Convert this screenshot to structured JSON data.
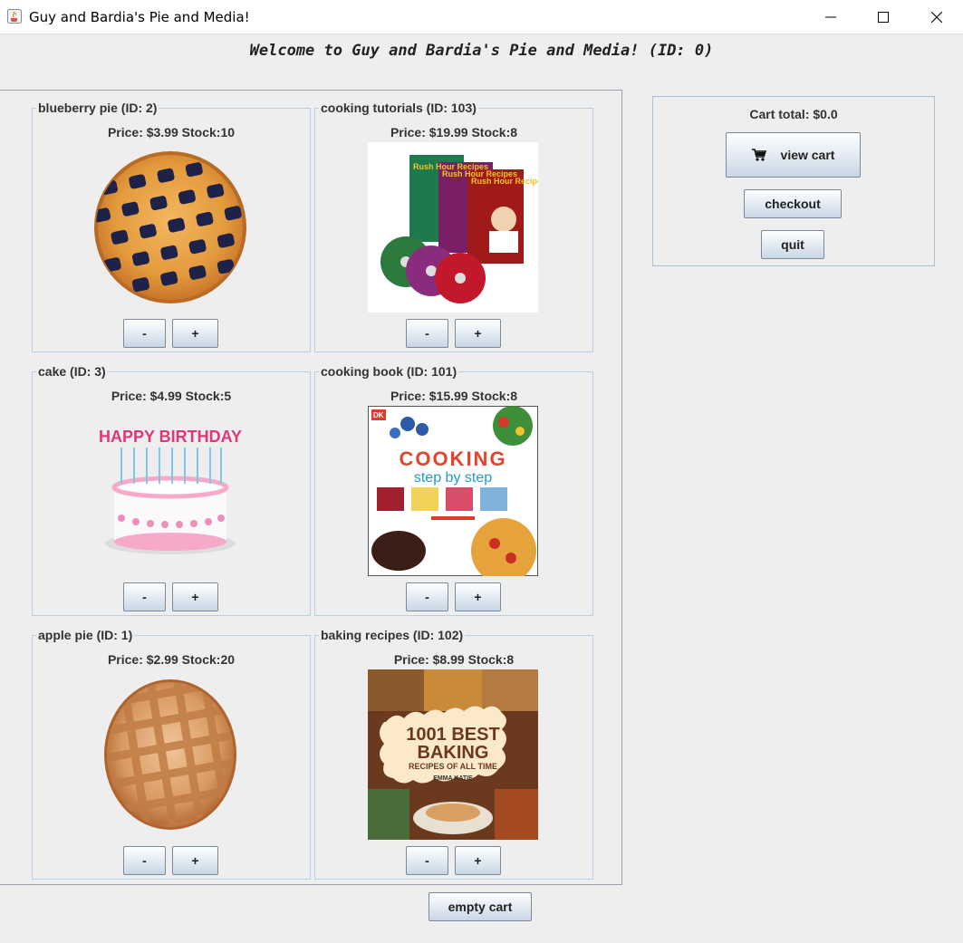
{
  "window": {
    "title": "Guy and Bardia's Pie and Media!",
    "controls": {
      "minimize": "minimize-icon",
      "maximize": "maximize-icon",
      "close": "close-icon"
    }
  },
  "welcome": "Welcome to Guy and Bardia's Pie and Media! (ID: 0)",
  "products": [
    {
      "name": "blueberry pie (ID: 2)",
      "info": "Price: $3.99 Stock:10",
      "image": "blueberry-pie-image"
    },
    {
      "name": "cooking tutorials (ID: 103)",
      "info": "Price: $19.99 Stock:8",
      "image": "cooking-tutorials-image",
      "image_text": {
        "logo": "Rush Hour Recipes"
      }
    },
    {
      "name": "cake (ID: 3)",
      "info": "Price: $4.99 Stock:5",
      "image": "birthday-cake-image",
      "image_text": {
        "candles": "HAPPY BIRTHDAY"
      }
    },
    {
      "name": "cooking book (ID: 101)",
      "info": "Price: $15.99 Stock:8",
      "image": "cooking-book-image",
      "image_text": {
        "publisher": "DK",
        "line1": "COOKING",
        "line2": "step by step"
      }
    },
    {
      "name": "apple pie (ID: 1)",
      "info": "Price: $2.99 Stock:20",
      "image": "apple-pie-image"
    },
    {
      "name": "baking recipes (ID: 102)",
      "info": "Price: $8.99 Stock:8",
      "image": "baking-book-image",
      "image_text": {
        "line1": "1001 BEST",
        "line2": "BAKING",
        "line3": "RECIPES OF ALL TIME",
        "author": "EMMA KATIE"
      }
    }
  ],
  "buttons": {
    "minus": "-",
    "plus": "+"
  },
  "cart": {
    "total": "Cart total: $0.0",
    "view_cart": "view cart",
    "view_cart_icon": "cart-icon",
    "checkout": "checkout",
    "quit": "quit"
  },
  "empty_cart": "empty cart",
  "colors": {
    "background": "#eeeeee",
    "border": "#b8cfe5",
    "button_top": "#ffffff",
    "button_bottom": "#c9d6e3"
  }
}
